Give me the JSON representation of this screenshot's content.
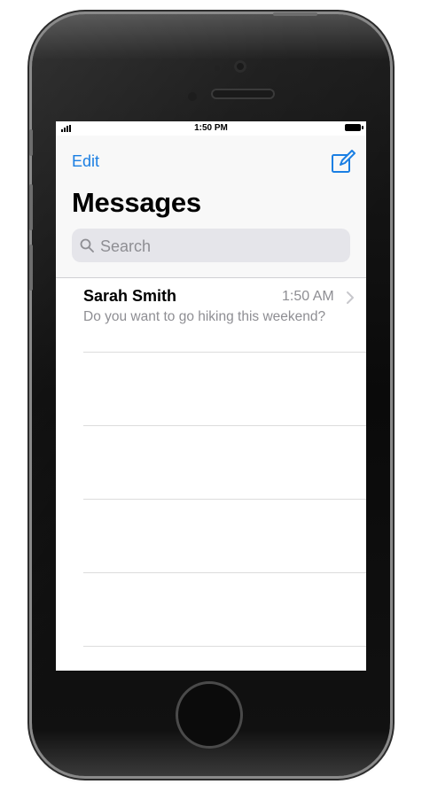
{
  "status_bar": {
    "time": "1:50 PM"
  },
  "nav": {
    "edit_label": "Edit",
    "title": "Messages",
    "compose_icon": "compose-icon"
  },
  "search": {
    "placeholder": "Search",
    "value": ""
  },
  "conversations": [
    {
      "name": "Sarah Smith",
      "time": "1:50 AM",
      "preview": "Do you want to go hiking this weekend?"
    }
  ],
  "colors": {
    "accent": "#1b7fe3",
    "secondary_text": "#8e8e93",
    "search_bg": "#e5e5ea",
    "device_body": "#0a0a0a"
  }
}
